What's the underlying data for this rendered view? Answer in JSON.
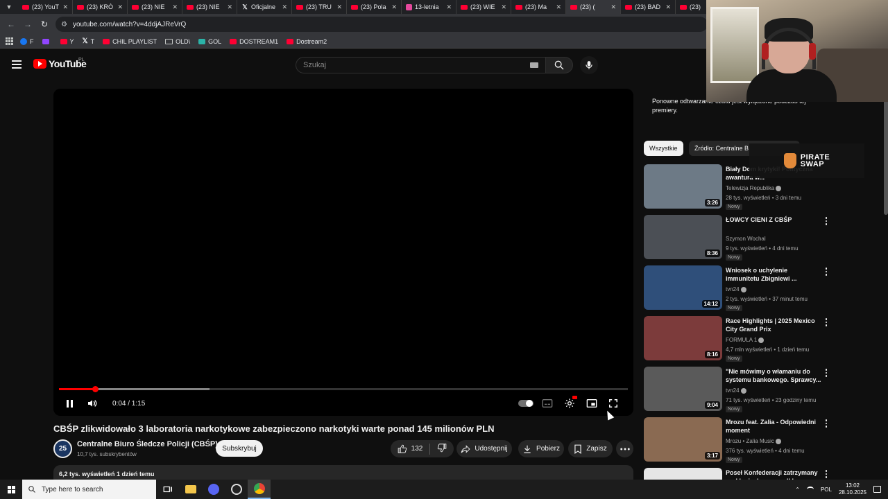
{
  "tabs": [
    {
      "title": "(23) YouT",
      "icon": "youtube-icon",
      "active": false
    },
    {
      "title": "(23) KRÓ",
      "icon": "youtube-icon",
      "active": false
    },
    {
      "title": "(23) NIE",
      "icon": "youtube-icon",
      "active": false
    },
    {
      "title": "(23) NIE",
      "icon": "youtube-icon",
      "active": false
    },
    {
      "title": "Oficjalne",
      "icon": "x-icon",
      "active": false
    },
    {
      "title": "(23) TRU",
      "icon": "youtube-icon",
      "active": false
    },
    {
      "title": "(23) Pola",
      "icon": "youtube-icon",
      "active": false
    },
    {
      "title": "13-letnia",
      "icon": "page-icon",
      "active": false
    },
    {
      "title": "(23) WIE",
      "icon": "youtube-icon",
      "active": false
    },
    {
      "title": "(23) Ma",
      "icon": "youtube-icon",
      "active": false
    },
    {
      "title": "(23) (",
      "icon": "youtube-icon",
      "active": true
    },
    {
      "title": "(23) BAD",
      "icon": "youtube-icon",
      "active": false
    },
    {
      "title": "(23) ",
      "icon": "youtube-icon",
      "active": false
    }
  ],
  "address_bar": {
    "url": "youtube.com/watch?v=4ddjAJReVrQ"
  },
  "bookmarks": [
    {
      "label": "F",
      "icon": "facebook-icon"
    },
    {
      "label": "",
      "icon": "twitch-icon"
    },
    {
      "label": "Y",
      "icon": "youtube-icon"
    },
    {
      "label": "T",
      "icon": "x-icon"
    },
    {
      "label": "CHIL PLAYLIST",
      "icon": "youtube-icon"
    },
    {
      "label": "OLD\\",
      "icon": "folder-icon"
    },
    {
      "label": "GOL",
      "icon": "gol-icon"
    },
    {
      "label": "DOSTREAM1",
      "icon": "youtube-icon"
    },
    {
      "label": "Dostream2",
      "icon": "youtube-icon"
    }
  ],
  "masthead": {
    "logo_text": "YouTube",
    "region": "PL",
    "search_placeholder": "Szukaj"
  },
  "player": {
    "time_current": "0:04",
    "time_total": "1:15",
    "time_display": "0:04 / 1:15",
    "progress_fraction": 0.063,
    "buffered_fraction": 0.265
  },
  "video": {
    "title": "CBŚP zlikwidowało 3 laboratoria narkotykowe zabezpieczono narkotyki warte ponad 145 milionów PLN",
    "channel_name": "Centralne Biuro Śledcze Policji (CBŚP)",
    "channel_subs": "10,7 tys. subskrybentów",
    "subscribe_label": "Subskrybuj",
    "like_count": "132",
    "share_label": "Udostępnij",
    "download_label": "Pobierz",
    "save_label": "Zapisz",
    "description_meta": "6,2 tys. wyświetleń  1 dzień temu"
  },
  "sidebar": {
    "premiere_text": "Ponowne odtwarzanie czatu jest wyłączone podczas tej premiery.",
    "chips": [
      "Wszystkie",
      "Źródło: Centralne B"
    ],
    "recommendations": [
      {
        "title": "Biały Dom krytyki! Polityczna awantura w...",
        "channel": "Telewizja Republika",
        "verified": true,
        "meta": "28 tys. wyświetleń • 3 dni temu",
        "badge": "Nowy",
        "duration": "3:26",
        "thumb": "#6d7a86"
      },
      {
        "title": "ŁOWCY CIENI Z CBŚP",
        "channel": "Szymon Wochal",
        "verified": false,
        "meta": "9 tys. wyświetleń • 4 dni temu",
        "badge": "Nowy",
        "duration": "8:36",
        "thumb": "#4b4f55"
      },
      {
        "title": "Wniosek o uchylenie immunitetu Zbigniewi ...",
        "channel": "tvn24",
        "verified": true,
        "meta": "2 tys. wyświetleń • 37 minut temu",
        "badge": "Nowy",
        "duration": "14:12",
        "thumb": "#2f4f7a"
      },
      {
        "title": "Race Highlights | 2025 Mexico City Grand Prix",
        "channel": "FORMULA 1",
        "verified": true,
        "meta": "4,7 mln wyświetleń • 1 dzień temu",
        "badge": "Nowy",
        "duration": "8:16",
        "thumb": "#7c3b3b"
      },
      {
        "title": "\"Nie mówimy o włamaniu do systemu bankowego. Sprawcy...",
        "channel": "tvn24",
        "verified": true,
        "meta": "71 tys. wyświetleń • 23 godziny temu",
        "badge": "Nowy",
        "duration": "9:04",
        "thumb": "#5a5a5a"
      },
      {
        "title": "Mrozu feat. Zalia - Odpowiedni moment",
        "channel": "Mrozu • Zalia Music",
        "verified": true,
        "meta": "376 tys. wyświetleń • 4 dni temu",
        "badge": "Nowy",
        "duration": "3:17",
        "thumb": "#8a6a52"
      },
      {
        "title": "Poseł Konfederacji zatrzymany w sklepie, bo wyszedł bez ...",
        "channel": "",
        "verified": false,
        "meta": "",
        "badge": "",
        "duration": "",
        "thumb": "#e6e6e6"
      }
    ]
  },
  "sponsor": {
    "brand_line1": "PIRATE",
    "brand_line2": "SWAP"
  },
  "taskbar": {
    "search_placeholder": "Type here to search",
    "language": "POL",
    "time": "13:02",
    "date": "28.10.2025"
  },
  "colors": {
    "youtube_red": "#ff0000",
    "background": "#0f0f0f",
    "surface": "#272727"
  }
}
